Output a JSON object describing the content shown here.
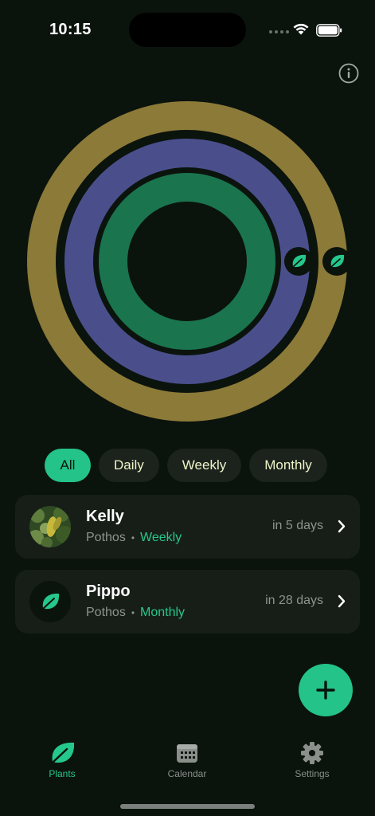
{
  "status_bar": {
    "time": "10:15"
  },
  "rings": {
    "outer_color": "#8c7a38",
    "middle_color": "#4a4f8c",
    "inner_color": "#1a744e",
    "marker_icon": "leaf-icon"
  },
  "filters": {
    "all": "All",
    "daily": "Daily",
    "weekly": "Weekly",
    "monthly": "Monthly",
    "selected": "All"
  },
  "plants": [
    {
      "name": "Kelly",
      "species": "Pothos",
      "frequency": "Weekly",
      "due": "in 5 days",
      "avatar": "photo"
    },
    {
      "name": "Pippo",
      "species": "Pothos",
      "frequency": "Monthly",
      "due": "in 28 days",
      "avatar": "leaf-icon"
    }
  ],
  "tabbar": {
    "plants": "Plants",
    "calendar": "Calendar",
    "settings": "Settings",
    "active": "Plants"
  },
  "colors": {
    "accent": "#23c38a",
    "background": "#0b130d",
    "card": "#171e18"
  }
}
